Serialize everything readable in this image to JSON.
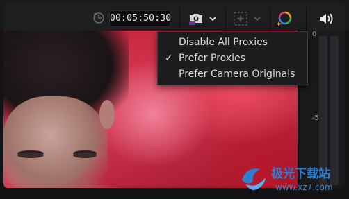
{
  "toolbar": {
    "timecode": "00:05:50:30"
  },
  "proxy_menu": {
    "items": [
      {
        "label": "Disable All Proxies",
        "checked": false
      },
      {
        "label": "Prefer Proxies",
        "checked": true
      },
      {
        "label": "Prefer Camera Originals",
        "checked": false
      }
    ],
    "check_glyph": "✓"
  },
  "audio_meter": {
    "labels": [
      "0",
      "-5"
    ]
  },
  "watermark": {
    "title": "极光下载站",
    "url": "www.xz7.com"
  },
  "colors": {
    "toolbar_bg": "#1e1e20",
    "menu_bg": "#1c1c1e",
    "viewer_red": "#d83a55"
  },
  "icons": {
    "clock": "clock-icon",
    "proxy": "proxy-camera-icon",
    "fx": "fx-sparkle-icon",
    "color": "color-wheel-icon",
    "audio": "speaker-icon"
  }
}
